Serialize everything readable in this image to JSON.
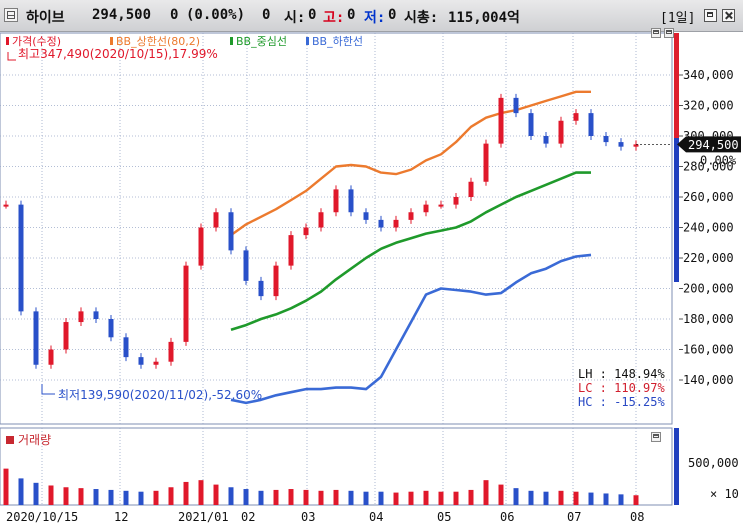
{
  "header": {
    "name": "하이브",
    "price": "294,500",
    "change": "0",
    "change_pct": "(0.00%)",
    "volume_label": "0",
    "open_label": "시:",
    "open_value": "0",
    "high_label": "고:",
    "high_value": "0",
    "low_label": "저:",
    "low_value": "0",
    "mcap_label": "시총:",
    "mcap_value": "115,004억",
    "period": "[1일]"
  },
  "legend": [
    "가격(수정)",
    "BB_상한선(80,2)",
    "BB_중심선",
    "BB_하한선"
  ],
  "annotations": {
    "high": "최고347,490(2020/10/15),17.99%",
    "low": "최저139,590(2020/11/02),-52.60%",
    "price_tag": "294,500",
    "pct_tag": "0.00%",
    "lh": "LH : 148.94%",
    "lc": "LC : 110.97%",
    "hc": "HC : -15.25%"
  },
  "volume_panel": {
    "title": "거래량",
    "tick_labels": [
      "500,000",
      "× 10"
    ]
  },
  "colors": {
    "up": "#e0182b",
    "down": "#2950c9",
    "bb_upper": "#ec7a2e",
    "bb_middle": "#1f9a2b",
    "bb_lower": "#3a6ad6",
    "grid": "#9aa9c8"
  },
  "chart_data": {
    "type": "line",
    "x": [
      "2020/10/15",
      "2020/10/22",
      "2020/10/29",
      "2020/11/05",
      "2020/11/12",
      "2020/11/19",
      "2020/11/26",
      "2020/12/03",
      "2020/12/10",
      "2020/12/17",
      "2020/12/24",
      "2020/12/31",
      "2021/01/07",
      "2021/01/14",
      "2021/01/21",
      "2021/01/28",
      "2021/02/04",
      "2021/02/11",
      "2021/02/18",
      "2021/02/25",
      "2021/03/04",
      "2021/03/11",
      "2021/03/18",
      "2021/03/25",
      "2021/04/01",
      "2021/04/08",
      "2021/04/15",
      "2021/04/22",
      "2021/04/29",
      "2021/05/06",
      "2021/05/13",
      "2021/05/20",
      "2021/05/27",
      "2021/06/03",
      "2021/06/10",
      "2021/06/17",
      "2021/06/24",
      "2021/07/01",
      "2021/07/08",
      "2021/07/15",
      "2021/07/22",
      "2021/07/29",
      "2021/08/05"
    ],
    "series": [
      {
        "name": "가격(수정)",
        "values": [
          255000,
          185000,
          150000,
          160000,
          178000,
          185000,
          180000,
          168000,
          155000,
          150000,
          152000,
          165000,
          215000,
          240000,
          250000,
          225000,
          205000,
          195000,
          215000,
          235000,
          240000,
          250000,
          265000,
          250000,
          245000,
          240000,
          245000,
          250000,
          255000,
          255000,
          260000,
          270000,
          295000,
          325000,
          315000,
          300000,
          295000,
          310000,
          315000,
          300000,
          296000,
          293000,
          294500
        ]
      },
      {
        "name": "BB_상한선(80,2)",
        "values": [
          null,
          null,
          null,
          null,
          null,
          null,
          null,
          null,
          null,
          null,
          null,
          null,
          null,
          null,
          null,
          235000,
          242000,
          247000,
          252000,
          258000,
          264000,
          272000,
          280000,
          281000,
          280000,
          276000,
          275000,
          278000,
          284000,
          288000,
          296000,
          306000,
          312000,
          315000,
          317000,
          320000,
          323000,
          326000,
          329000,
          329000,
          null,
          null,
          null
        ]
      },
      {
        "name": "BB_중심선",
        "values": [
          null,
          null,
          null,
          null,
          null,
          null,
          null,
          null,
          null,
          null,
          null,
          null,
          null,
          null,
          null,
          173000,
          176000,
          180000,
          183000,
          187000,
          192000,
          198000,
          206000,
          213000,
          220000,
          226000,
          230000,
          233000,
          236000,
          238000,
          240000,
          244000,
          250000,
          255000,
          260000,
          264000,
          268000,
          272000,
          276000,
          276000,
          null,
          null,
          null
        ]
      },
      {
        "name": "BB_하한선",
        "values": [
          null,
          null,
          null,
          null,
          null,
          null,
          null,
          null,
          null,
          null,
          null,
          null,
          null,
          null,
          null,
          127000,
          125000,
          127000,
          130000,
          132000,
          134000,
          134000,
          135000,
          135000,
          134000,
          142000,
          160000,
          178000,
          196000,
          200000,
          199000,
          198000,
          196000,
          197000,
          204000,
          210000,
          213000,
          218000,
          221000,
          222000,
          null,
          null,
          null
        ]
      }
    ],
    "volume": [
      410000,
      300000,
      250000,
      220000,
      200000,
      190000,
      180000,
      170000,
      160000,
      150000,
      160000,
      200000,
      260000,
      280000,
      230000,
      200000,
      180000,
      160000,
      170000,
      180000,
      170000,
      160000,
      170000,
      160000,
      150000,
      150000,
      140000,
      150000,
      160000,
      150000,
      150000,
      170000,
      280000,
      230000,
      190000,
      160000,
      150000,
      160000,
      150000,
      140000,
      130000,
      120000,
      110000
    ],
    "x_tick_labels": [
      "2020/10/15",
      "12",
      "2021/01",
      "02",
      "03",
      "04",
      "05",
      "06",
      "07",
      "08"
    ],
    "y_tick_labels": [
      "340,000",
      "320,000",
      "300,000",
      "280,000",
      "260,000",
      "240,000",
      "220,000",
      "200,000",
      "180,000",
      "160,000",
      "140,000"
    ],
    "ylim": [
      125000,
      352000
    ],
    "volume_ylim": [
      0,
      620000
    ],
    "grid": true,
    "legend_position": "top-left"
  }
}
